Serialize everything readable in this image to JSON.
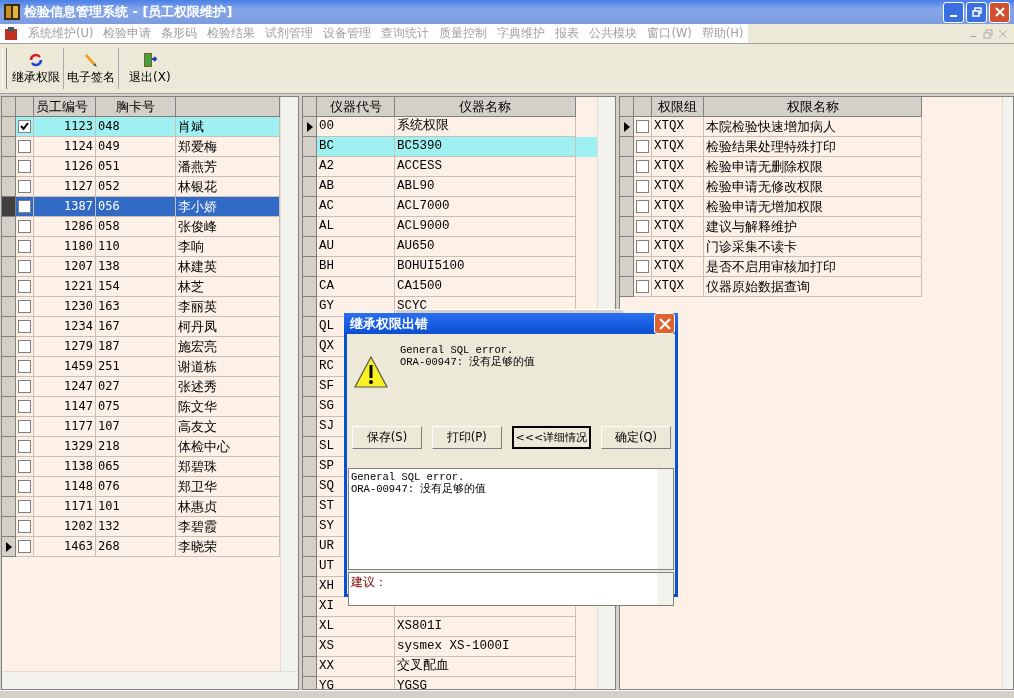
{
  "window": {
    "title": "检验信息管理系统 - [员工权限维护]"
  },
  "menu": [
    {
      "label": "系统维护(U)",
      "disabled": true
    },
    {
      "label": "检验申请",
      "disabled": true
    },
    {
      "label": "条形码",
      "disabled": true
    },
    {
      "label": "检验结果",
      "disabled": true
    },
    {
      "label": "试剂管理",
      "disabled": true
    },
    {
      "label": "设备管理",
      "disabled": true
    },
    {
      "label": "查询统计",
      "disabled": true
    },
    {
      "label": "质量控制",
      "disabled": true
    },
    {
      "label": "字典维护",
      "disabled": true
    },
    {
      "label": "报表",
      "disabled": true
    },
    {
      "label": "公共模块",
      "disabled": true
    },
    {
      "label": "窗口(W)",
      "disabled": true
    },
    {
      "label": "帮助(H)",
      "disabled": true
    }
  ],
  "toolbar": [
    {
      "label": "继承权限",
      "kind": "inherit"
    },
    {
      "label": "电子签名",
      "kind": "sign"
    },
    {
      "label": "退出(X)",
      "kind": "exit"
    }
  ],
  "employees": {
    "columns": [
      "员工编号",
      "胸卡号"
    ],
    "rows": [
      {
        "id": "1123",
        "card": "048",
        "name": "肖斌",
        "checked": true,
        "highlighted": true,
        "selected": false,
        "pointer": false
      },
      {
        "id": "1124",
        "card": "049",
        "name": "郑爱梅",
        "checked": false,
        "highlighted": false,
        "selected": false,
        "pointer": false
      },
      {
        "id": "1126",
        "card": "051",
        "name": "潘燕芳",
        "checked": false,
        "highlighted": false,
        "selected": false,
        "pointer": false
      },
      {
        "id": "1127",
        "card": "052",
        "name": "林银花",
        "checked": false,
        "highlighted": false,
        "selected": false,
        "pointer": false
      },
      {
        "id": "1387",
        "card": "056",
        "name": "李小娇",
        "checked": false,
        "highlighted": false,
        "selected": true,
        "pointer": false
      },
      {
        "id": "1286",
        "card": "058",
        "name": "张俊峰",
        "checked": false,
        "highlighted": false,
        "selected": false,
        "pointer": false
      },
      {
        "id": "1180",
        "card": "110",
        "name": "李响",
        "checked": false,
        "highlighted": false,
        "selected": false,
        "pointer": false
      },
      {
        "id": "1207",
        "card": "138",
        "name": "林建英",
        "checked": false,
        "highlighted": false,
        "selected": false,
        "pointer": false
      },
      {
        "id": "1221",
        "card": "154",
        "name": "林芝",
        "checked": false,
        "highlighted": false,
        "selected": false,
        "pointer": false
      },
      {
        "id": "1230",
        "card": "163",
        "name": "李丽英",
        "checked": false,
        "highlighted": false,
        "selected": false,
        "pointer": false
      },
      {
        "id": "1234",
        "card": "167",
        "name": "柯丹凤",
        "checked": false,
        "highlighted": false,
        "selected": false,
        "pointer": false
      },
      {
        "id": "1279",
        "card": "187",
        "name": "施宏亮",
        "checked": false,
        "highlighted": false,
        "selected": false,
        "pointer": false
      },
      {
        "id": "1459",
        "card": "251",
        "name": "谢道栋",
        "checked": false,
        "highlighted": false,
        "selected": false,
        "pointer": false
      },
      {
        "id": "1247",
        "card": "027",
        "name": "张述秀",
        "checked": false,
        "highlighted": false,
        "selected": false,
        "pointer": false
      },
      {
        "id": "1147",
        "card": "075",
        "name": "陈文华",
        "checked": false,
        "highlighted": false,
        "selected": false,
        "pointer": false
      },
      {
        "id": "1177",
        "card": "107",
        "name": "高友文",
        "checked": false,
        "highlighted": false,
        "selected": false,
        "pointer": false
      },
      {
        "id": "1329",
        "card": "218",
        "name": "体检中心",
        "checked": false,
        "highlighted": false,
        "selected": false,
        "pointer": false
      },
      {
        "id": "1138",
        "card": "065",
        "name": "郑碧珠",
        "checked": false,
        "highlighted": false,
        "selected": false,
        "pointer": false
      },
      {
        "id": "1148",
        "card": "076",
        "name": "郑卫华",
        "checked": false,
        "highlighted": false,
        "selected": false,
        "pointer": false
      },
      {
        "id": "1171",
        "card": "101",
        "name": "林惠贞",
        "checked": false,
        "highlighted": false,
        "selected": false,
        "pointer": false
      },
      {
        "id": "1202",
        "card": "132",
        "name": "李碧霞",
        "checked": false,
        "highlighted": false,
        "selected": false,
        "pointer": false
      },
      {
        "id": "1463",
        "card": "268",
        "name": "李晓荣",
        "checked": false,
        "highlighted": false,
        "selected": false,
        "pointer": true
      }
    ]
  },
  "instruments": {
    "columns": [
      "仪器代号",
      "仪器名称"
    ],
    "rows": [
      {
        "code": "00",
        "name": "系统权限",
        "highlighted": false,
        "pointer": true
      },
      {
        "code": "BC",
        "name": "BC5390",
        "highlighted": true,
        "pointer": false
      },
      {
        "code": "A2",
        "name": "ACCESS",
        "highlighted": false,
        "pointer": false
      },
      {
        "code": "AB",
        "name": "ABL90",
        "highlighted": false,
        "pointer": false
      },
      {
        "code": "AC",
        "name": "ACL7000",
        "highlighted": false,
        "pointer": false
      },
      {
        "code": "AL",
        "name": "ACL9000",
        "highlighted": false,
        "pointer": false
      },
      {
        "code": "AU",
        "name": "AU650",
        "highlighted": false,
        "pointer": false
      },
      {
        "code": "BH",
        "name": "BOHUI5100",
        "highlighted": false,
        "pointer": false
      },
      {
        "code": "CA",
        "name": "CA1500",
        "highlighted": false,
        "pointer": false
      },
      {
        "code": "GY",
        "name": "SCYC",
        "highlighted": false,
        "pointer": false
      },
      {
        "code": "QL",
        "highlighted": false,
        "pointer": false
      },
      {
        "code": "QX",
        "highlighted": false,
        "pointer": false
      },
      {
        "code": "RC",
        "highlighted": false,
        "pointer": false
      },
      {
        "code": "SF",
        "highlighted": false,
        "pointer": false
      },
      {
        "code": "SG",
        "highlighted": false,
        "pointer": false
      },
      {
        "code": "SJ",
        "highlighted": false,
        "pointer": false
      },
      {
        "code": "SL",
        "highlighted": false,
        "pointer": false
      },
      {
        "code": "SP",
        "highlighted": false,
        "pointer": false
      },
      {
        "code": "SQ",
        "highlighted": false,
        "pointer": false
      },
      {
        "code": "ST",
        "highlighted": false,
        "pointer": false
      },
      {
        "code": "SY",
        "highlighted": false,
        "pointer": false
      },
      {
        "code": "UR",
        "highlighted": false,
        "pointer": false
      },
      {
        "code": "UT",
        "highlighted": false,
        "pointer": false
      },
      {
        "code": "XH",
        "highlighted": false,
        "pointer": false
      },
      {
        "code": "XI",
        "highlighted": false,
        "pointer": false
      },
      {
        "code": "XL",
        "name": "XS801I",
        "highlighted": false,
        "pointer": false
      },
      {
        "code": "XS",
        "name": "sysmex XS-1000I",
        "highlighted": false,
        "pointer": false
      },
      {
        "code": "XX",
        "name": "交叉配血",
        "highlighted": false,
        "pointer": false
      },
      {
        "code": "YG",
        "name": "YGSG",
        "highlighted": false,
        "pointer": false
      }
    ]
  },
  "permissions": {
    "columns": [
      "权限组",
      "权限名称"
    ],
    "rows": [
      {
        "group": "XTQX",
        "name": "本院检验快速增加病人",
        "checked": false,
        "pointer": true
      },
      {
        "group": "XTQX",
        "name": "检验结果处理特殊打印",
        "checked": false,
        "pointer": false
      },
      {
        "group": "XTQX",
        "name": "检验申请无删除权限",
        "checked": false,
        "pointer": false
      },
      {
        "group": "XTQX",
        "name": "检验申请无修改权限",
        "checked": false,
        "pointer": false
      },
      {
        "group": "XTQX",
        "name": "检验申请无增加权限",
        "checked": false,
        "pointer": false
      },
      {
        "group": "XTQX",
        "name": "建议与解释维护",
        "checked": false,
        "pointer": false
      },
      {
        "group": "XTQX",
        "name": "门诊采集不读卡",
        "checked": false,
        "pointer": false
      },
      {
        "group": "XTQX",
        "name": "是否不启用审核加打印",
        "checked": false,
        "pointer": false
      },
      {
        "group": "XTQX",
        "name": "仪器原始数据查询",
        "checked": false,
        "pointer": false
      }
    ]
  },
  "dialog": {
    "title": "继承权限出错",
    "message": [
      "General SQL error.",
      "ORA-00947: 没有足够的值"
    ],
    "buttons": [
      {
        "label": "保存(S)",
        "focused": false
      },
      {
        "label": "打印(P)",
        "focused": false
      },
      {
        "label": "<<<详细情况",
        "focused": true
      },
      {
        "label": "确定(Q)",
        "focused": false
      }
    ],
    "details": [
      "General SQL error.",
      "ORA-00947: 没有足够的值"
    ],
    "advice_label": "建议："
  }
}
